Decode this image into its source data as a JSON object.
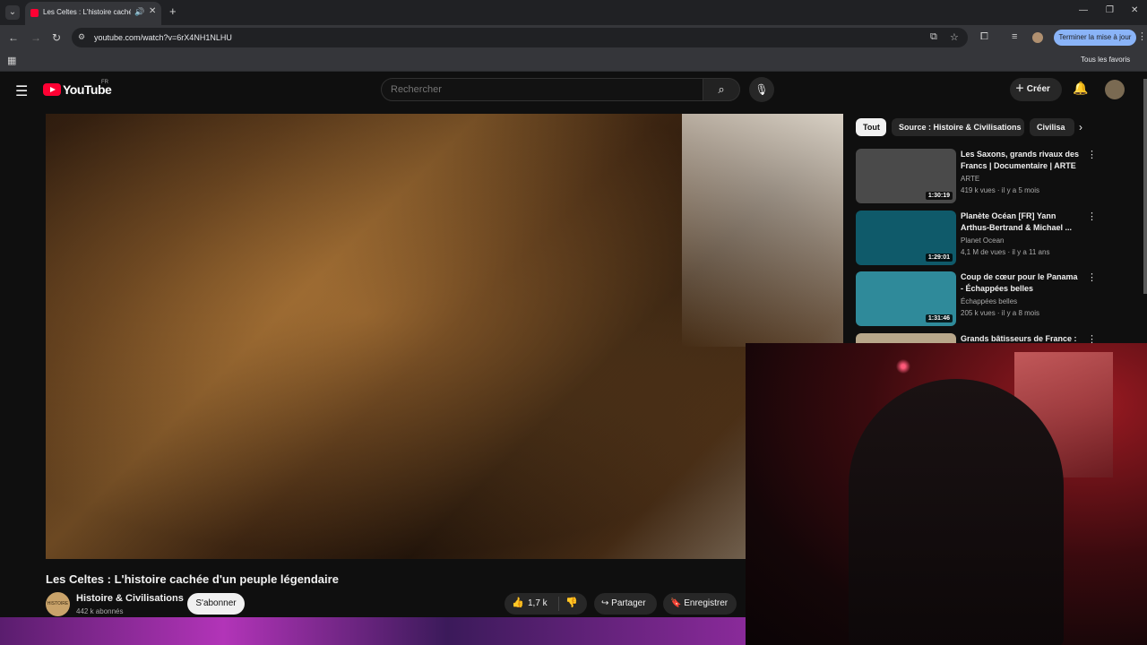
{
  "browser": {
    "tab_title": "Les Celtes : L'histoire cachée",
    "url": "youtube.com/watch?v=6rX4NH1NLHU",
    "update_label": "Terminer la mise à jour",
    "bookmarks_folder": "Tous les favoris"
  },
  "youtube": {
    "wordmark": "YouTube",
    "country": "FR",
    "search_placeholder": "Rechercher",
    "create_label": "Créer"
  },
  "video": {
    "title": "Les Celtes : L'histoire cachée d'un peuple légendaire",
    "channel": "Histoire & Civilisations",
    "subscribers": "442 k abonnés",
    "subscribe_label": "S'abonner",
    "likes": "1,7 k",
    "share_label": "Partager",
    "save_label": "Enregistrer"
  },
  "chips": [
    "Tout",
    "Source : Histoire & Civilisations",
    "Civilisa"
  ],
  "recommendations": [
    {
      "title": "Les Saxons, grands rivaux des Francs | Documentaire | ARTE",
      "channel": "ARTE",
      "meta": "419 k vues · il y a 5 mois",
      "duration": "1:30:19",
      "thumb_color": "#4a4a4a"
    },
    {
      "title": "Planète Océan [FR] Yann Arthus-Bertrand & Michael ...",
      "channel": "Planet Ocean",
      "meta": "4,1 M de vues · il y a 11 ans",
      "duration": "1:29:01",
      "thumb_color": "#0f5a6a"
    },
    {
      "title": "Coup de cœur pour le Panama - Échappées belles",
      "channel": "Échappées belles",
      "meta": "205 k vues · il y a 8 mois",
      "duration": "1:31:46",
      "thumb_color": "#2f8a9a"
    },
    {
      "title": "Grands bâtisseurs de France :",
      "channel": "",
      "meta": "",
      "duration": "",
      "thumb_color": "#b8a78a"
    }
  ],
  "colors": {
    "accent": "#ff0033",
    "update_button": "#8ab4f8"
  }
}
